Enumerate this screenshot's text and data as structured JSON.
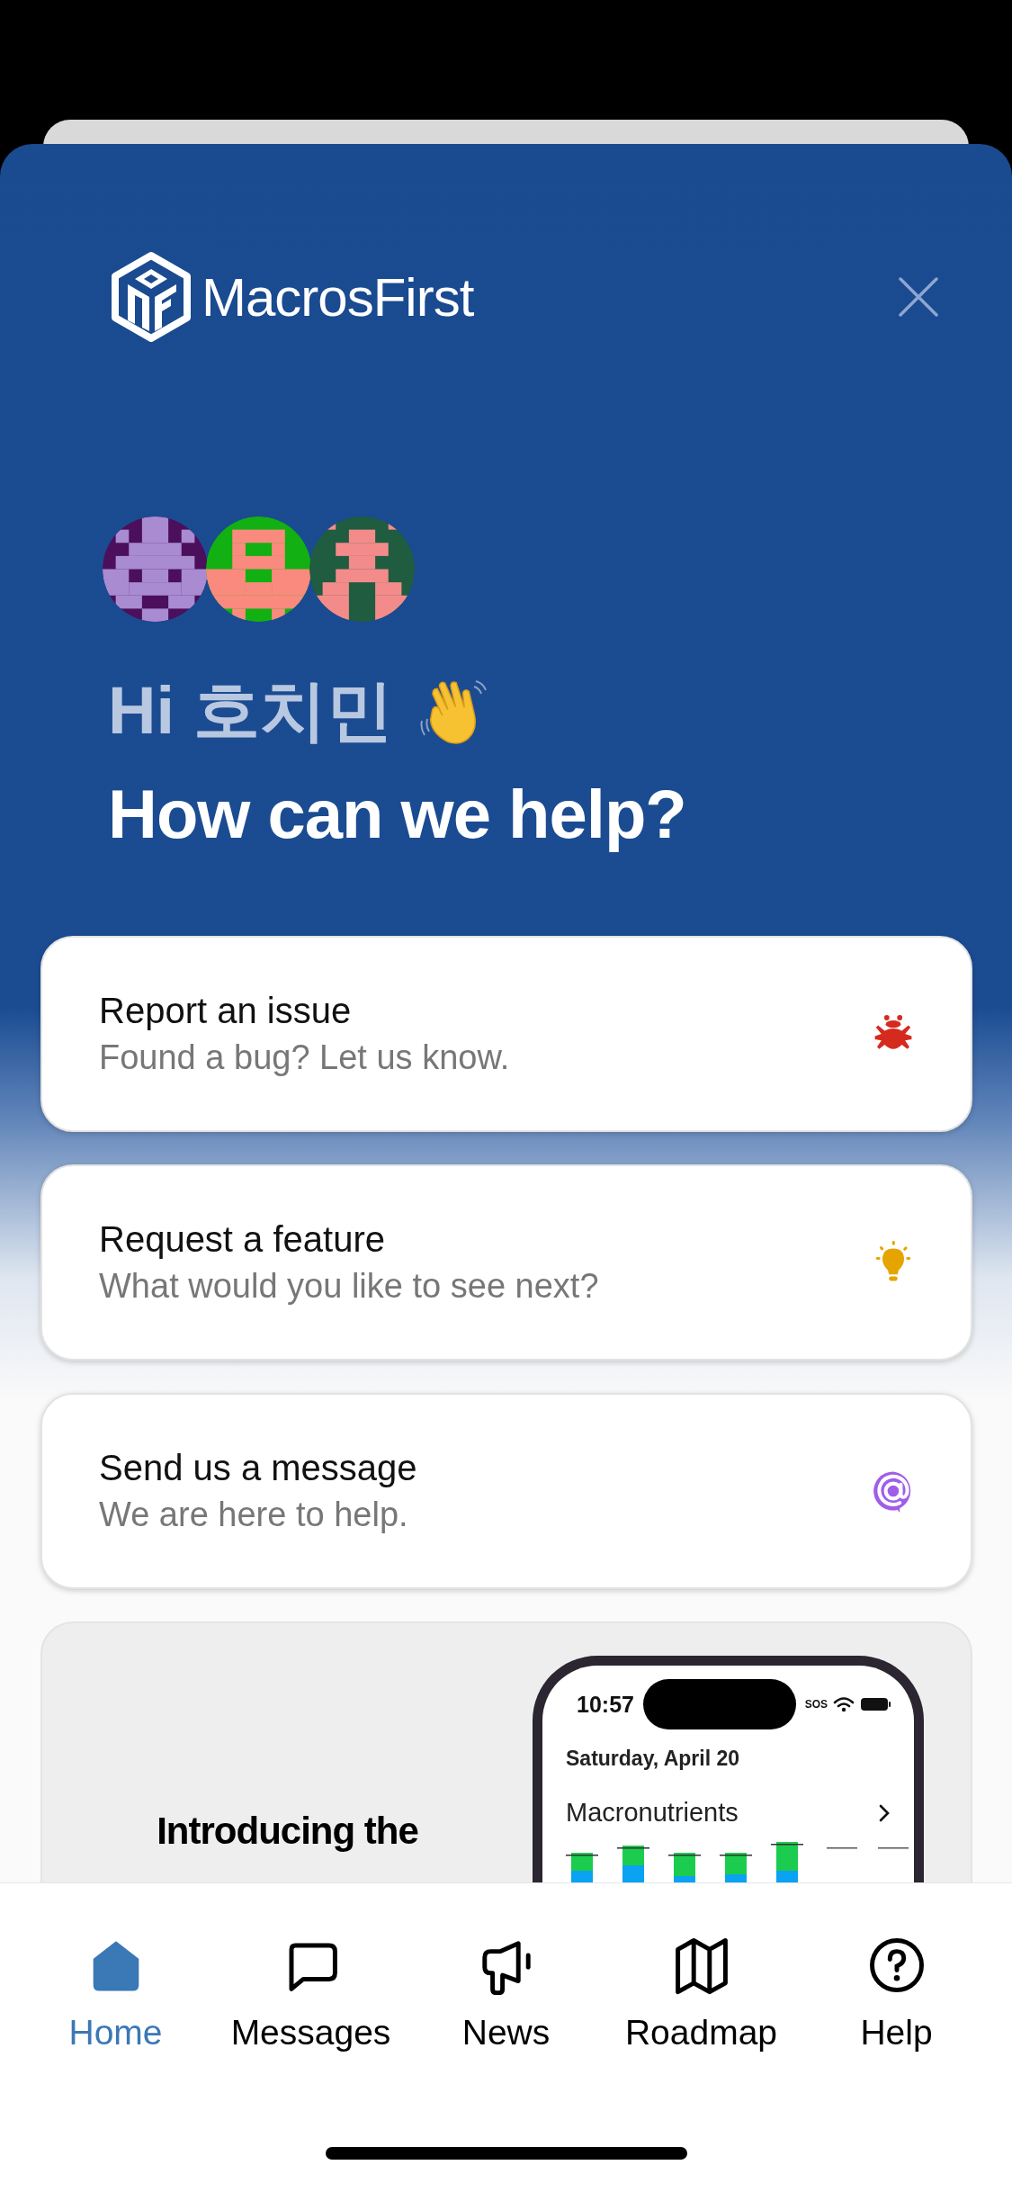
{
  "header": {
    "logo_text": "MacrosFirst"
  },
  "avatars": [
    {
      "color": "#4b0f5c"
    },
    {
      "color": "#12b012"
    },
    {
      "color": "#1f5c40"
    }
  ],
  "greeting": "Hi 호치민",
  "headline": "How can we help?",
  "actions": [
    {
      "kind": "bug",
      "title": "Report an issue",
      "subtitle": "Found a bug? Let us know."
    },
    {
      "kind": "idea",
      "title": "Request a feature",
      "subtitle": "What would you like to see next?"
    },
    {
      "kind": "message",
      "title": "Send us a message",
      "subtitle": "We are here to help."
    }
  ],
  "promo": {
    "title": "Introducing the",
    "phone": {
      "time": "10:57",
      "status": "SOS",
      "date": "Saturday, April 20",
      "section": "Macronutrients"
    }
  },
  "tabs": [
    {
      "kind": "home",
      "label": "Home",
      "selected": true
    },
    {
      "kind": "messages",
      "label": "Messages",
      "selected": false
    },
    {
      "kind": "news",
      "label": "News",
      "selected": false
    },
    {
      "kind": "roadmap",
      "label": "Roadmap",
      "selected": false
    },
    {
      "kind": "help",
      "label": "Help",
      "selected": false
    }
  ]
}
